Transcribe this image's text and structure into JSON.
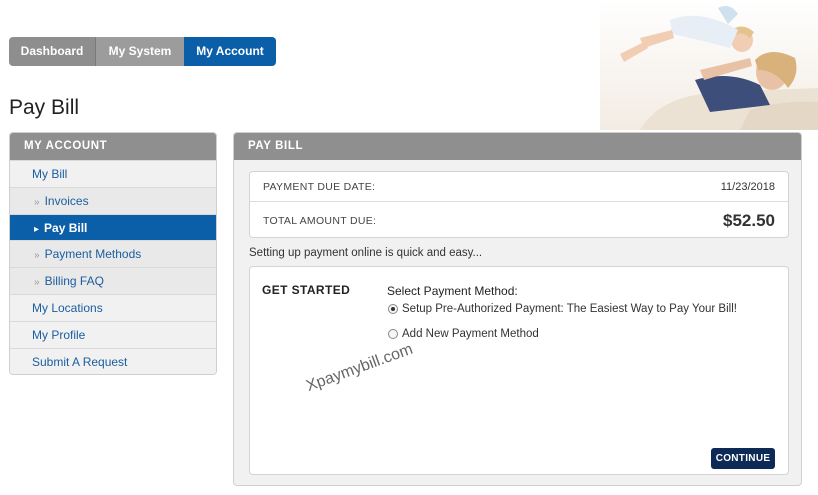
{
  "nav": {
    "tabs": [
      {
        "label": "Dashboard"
      },
      {
        "label": "My System"
      },
      {
        "label": "My Account"
      }
    ]
  },
  "page_title": "Pay Bill",
  "sidebar": {
    "heading": "MY ACCOUNT",
    "items": [
      {
        "label": "My Bill"
      },
      {
        "label": "Invoices"
      },
      {
        "label": "Pay Bill"
      },
      {
        "label": "Payment Methods"
      },
      {
        "label": "Billing FAQ"
      },
      {
        "label": "My Locations"
      },
      {
        "label": "My Profile"
      },
      {
        "label": "Submit A Request"
      }
    ],
    "bullet": "»",
    "active_bullet": "▸"
  },
  "main": {
    "heading": "PAY BILL",
    "due_date_label": "PAYMENT DUE DATE:",
    "due_date_value": "11/23/2018",
    "total_label": "TOTAL AMOUNT DUE:",
    "total_value": "$52.50",
    "intro": "Setting up payment online is quick and easy...",
    "get_started": "GET STARTED",
    "select_label": "Select Payment Method:",
    "options": [
      {
        "label": "Setup Pre-Authorized Payment: The Easiest Way to Pay Your Bill!",
        "selected": true
      },
      {
        "label": "Add New Payment Method",
        "selected": false
      }
    ],
    "continue_label": "CONTINUE",
    "watermark": "Xpaymybill.com"
  },
  "colors": {
    "accent": "#0b5ea8",
    "header_gray": "#8f8f8f",
    "continue_bg": "#0d2a56"
  }
}
